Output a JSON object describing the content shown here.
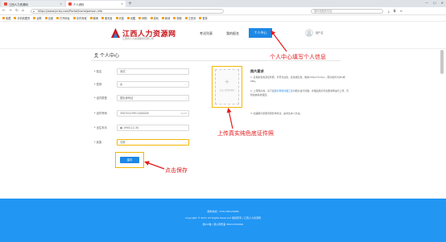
{
  "browser": {
    "tab_inactive": "江西人力资源网",
    "tab_active": "个人资料",
    "new_tab": "+",
    "url": "https://www.jxrlzy.com/Portal/home/person-info",
    "url_domain": "www.jxrl.com",
    "search_placeholder": "搜你想搜的内容",
    "bookmarks": [
      "收藏",
      "手机收藏夹",
      "谷歌",
      "百度",
      "打开网址",
      "京东商城",
      "微博",
      "爱淘宝",
      "天猫",
      "优酷",
      "网购",
      "游戏",
      "新闻",
      "视频",
      "江西省",
      "登录"
    ]
  },
  "header": {
    "logo_title": "江西人力资源网",
    "logo_sub": "江西省人力资源服务有限公司",
    "nav": {
      "exam_list": "考试列表",
      "my_signup": "我的报名",
      "personal_center": "个人中心"
    },
    "username": "用户名"
  },
  "page": {
    "title": "个人中心"
  },
  "form": {
    "fields": [
      {
        "label": "* 姓名",
        "value": "测试"
      },
      {
        "label": "* 性别",
        "value": "女"
      },
      {
        "label": "* 证件类型",
        "value": "居民身份证"
      },
      {
        "label": "* 证件号码",
        "value": "3507021991120000X",
        "counter": "18/18"
      },
      {
        "label": "* 出生年月",
        "value": "1990-12-30"
      },
      {
        "label": "* 民族",
        "value": "汉族"
      }
    ],
    "save_label": "保存"
  },
  "photo": {
    "upload_hint": "点击上传证件照片",
    "req_title": "照片要求",
    "req_items": [
      "1. 近期彩色免冠证件照，背景为白色、蓝色或红色，像素200px*413px，照片格式为JPG或PNG。",
      "2. 上传照片前，请下载",
      "3. 如遇照片质量问题影响考试，由考生本人负责。"
    ],
    "req_link": "照片审核处理工具",
    "req_item2_rest": "对照片进行处理，处理后照片符合要求再进行上传，否则会被系统退回。"
  },
  "annotations": {
    "a1": "个人中心填写个人信息",
    "a2": "上传真实纯色底证件照",
    "a3": "点击保存"
  },
  "footer": {
    "line1": "服务热线：0791-86123086",
    "line2": "Copyright © 2021 All Rights Reserved 版权所有 | 江西人力资源网",
    "line3": "赣ICP备 | 赣公网安备 36010302000"
  },
  "colors": {
    "accent": "#1e88e5",
    "annotation": "#e5191c",
    "highlight": "#f2b705",
    "logo": "#c8161d",
    "footer": "#2196f3"
  }
}
